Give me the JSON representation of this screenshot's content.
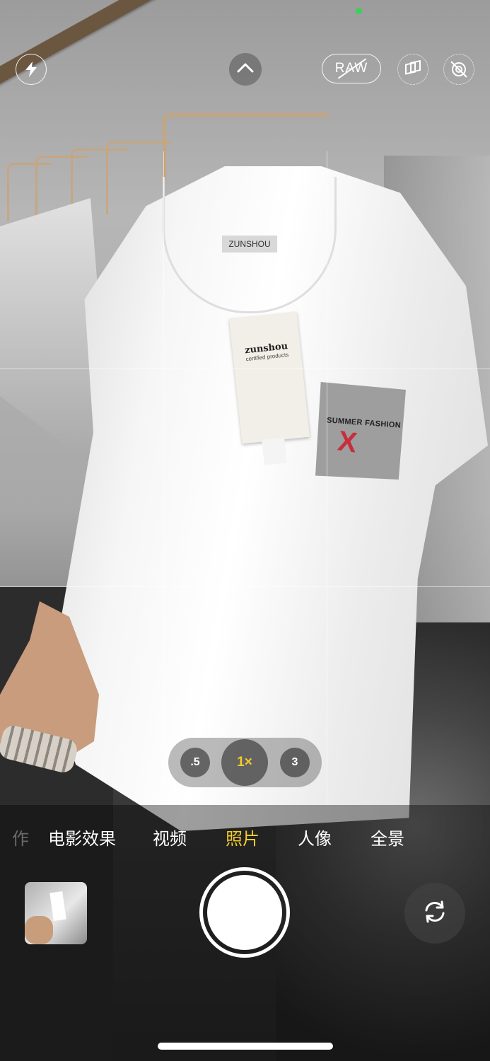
{
  "camera": {
    "top_bar": {
      "raw_label": "RAW",
      "flash_icon": "lightning-bolt-icon",
      "controls_toggle_icon": "chevron-up-icon",
      "live_photo_icon": "live-photo-off-icon",
      "styles_icon": "photographic-styles-icon"
    },
    "scene_text": {
      "collar_label": "ZUNSHOU",
      "hangtag_brand": "zunshou",
      "hangtag_sub": "certified products",
      "pocket_print": "SUMMER FASHION",
      "pocket_mark": "X"
    },
    "zoom": {
      "options": [
        ".5",
        "1×",
        "3"
      ],
      "selected": "1×"
    },
    "modes": {
      "partial_left": "作",
      "items": [
        "电影效果",
        "视频",
        "照片",
        "人像",
        "全景"
      ],
      "active": "照片"
    },
    "bottom": {
      "thumbnail_icon": "last-photo-thumbnail",
      "shutter_icon": "shutter-button",
      "flip_icon": "camera-flip-icon"
    },
    "colors": {
      "accent": "#f5cc2c",
      "indicator": "#3ccf5c"
    }
  }
}
